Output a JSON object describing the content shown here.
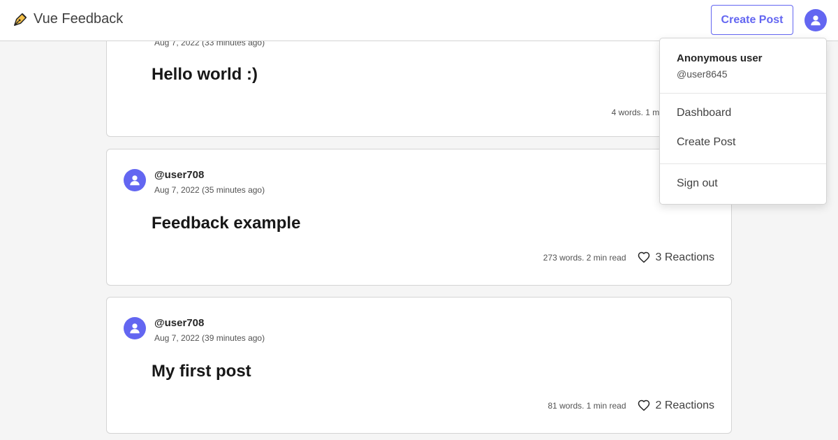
{
  "app": {
    "title": "Vue Feedback",
    "logo_icon": "pen-nib-icon"
  },
  "header": {
    "create_post_label": "Create Post",
    "avatar_icon": "user-icon"
  },
  "colors": {
    "accent": "#6366f1",
    "border": "#d4d4d4",
    "background": "#f5f5f5"
  },
  "posts": [
    {
      "author": "",
      "date": "Aug 7, 2022 (33 minutes ago)",
      "title": "Hello world :)",
      "read_info": "4 words. 1 min read",
      "reactions": ""
    },
    {
      "author": "@user708",
      "date": "Aug 7, 2022 (35 minutes ago)",
      "title": "Feedback example",
      "read_info": "273 words. 2 min read",
      "reactions": "3 Reactions"
    },
    {
      "author": "@user708",
      "date": "Aug 7, 2022 (39 minutes ago)",
      "title": "My first post",
      "read_info": "81 words. 1 min read",
      "reactions": "2 Reactions"
    }
  ],
  "menu": {
    "user_name": "Anonymous user",
    "user_handle": "@user8645",
    "items": [
      "Dashboard",
      "Create Post"
    ],
    "sign_out": "Sign out"
  }
}
